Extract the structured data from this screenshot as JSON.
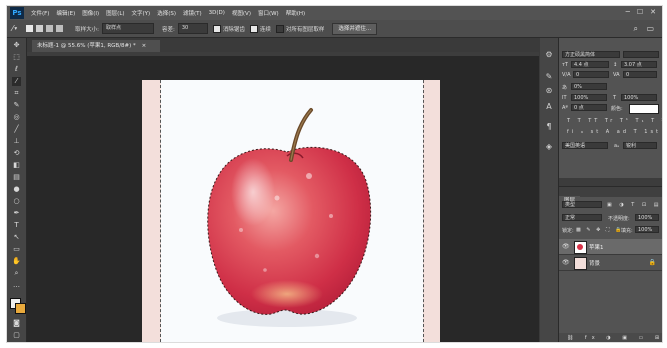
{
  "menu": {
    "logo": "Ps",
    "items": [
      "文件(F)",
      "编辑(E)",
      "图像(I)",
      "图层(L)",
      "文字(Y)",
      "选择(S)",
      "滤镜(T)",
      "3D(D)",
      "视图(V)",
      "窗口(W)",
      "帮助(H)"
    ],
    "window_controls": [
      "─",
      "☐",
      "✕"
    ]
  },
  "options": {
    "size_label": "取样大小:",
    "size_value": "取样点",
    "tolerance_label": "容差:",
    "tolerance_value": "30",
    "antialias": "消除锯齿",
    "contiguous": "连续",
    "sample_all": "对所有图层取样",
    "refine_button": "选择并遮住..."
  },
  "document": {
    "tab_title": "未标题-1 @ 55.6% (苹果1, RGB/8#) *",
    "tab_close": "×"
  },
  "character": {
    "font_family": "方正硕黑简体",
    "font_size": "4.4 点",
    "leading": "3.07 点",
    "kerning": "0",
    "tracking": "0",
    "scale_pct": "0%",
    "vscale": "100%",
    "hscale": "100%",
    "baseline": "0 点",
    "color_label": "颜色:",
    "language": "美国英语",
    "aa_label": "锐利",
    "aa_prefix": "aₐ"
  },
  "layers": {
    "tab_label": "图层",
    "filter_label": "类型",
    "blend_mode": "正常",
    "opacity_label": "不透明度:",
    "opacity_value": "100%",
    "lock_label": "锁定:",
    "fill_label": "填充:",
    "fill_value": "100%",
    "items": [
      {
        "name": "苹果1",
        "selected": true
      },
      {
        "name": "背景",
        "selected": false
      }
    ]
  },
  "colors": {
    "accent": "#31a8ff",
    "canvas_bg": "#f3dfdb",
    "apple_red": "#d9344a"
  }
}
